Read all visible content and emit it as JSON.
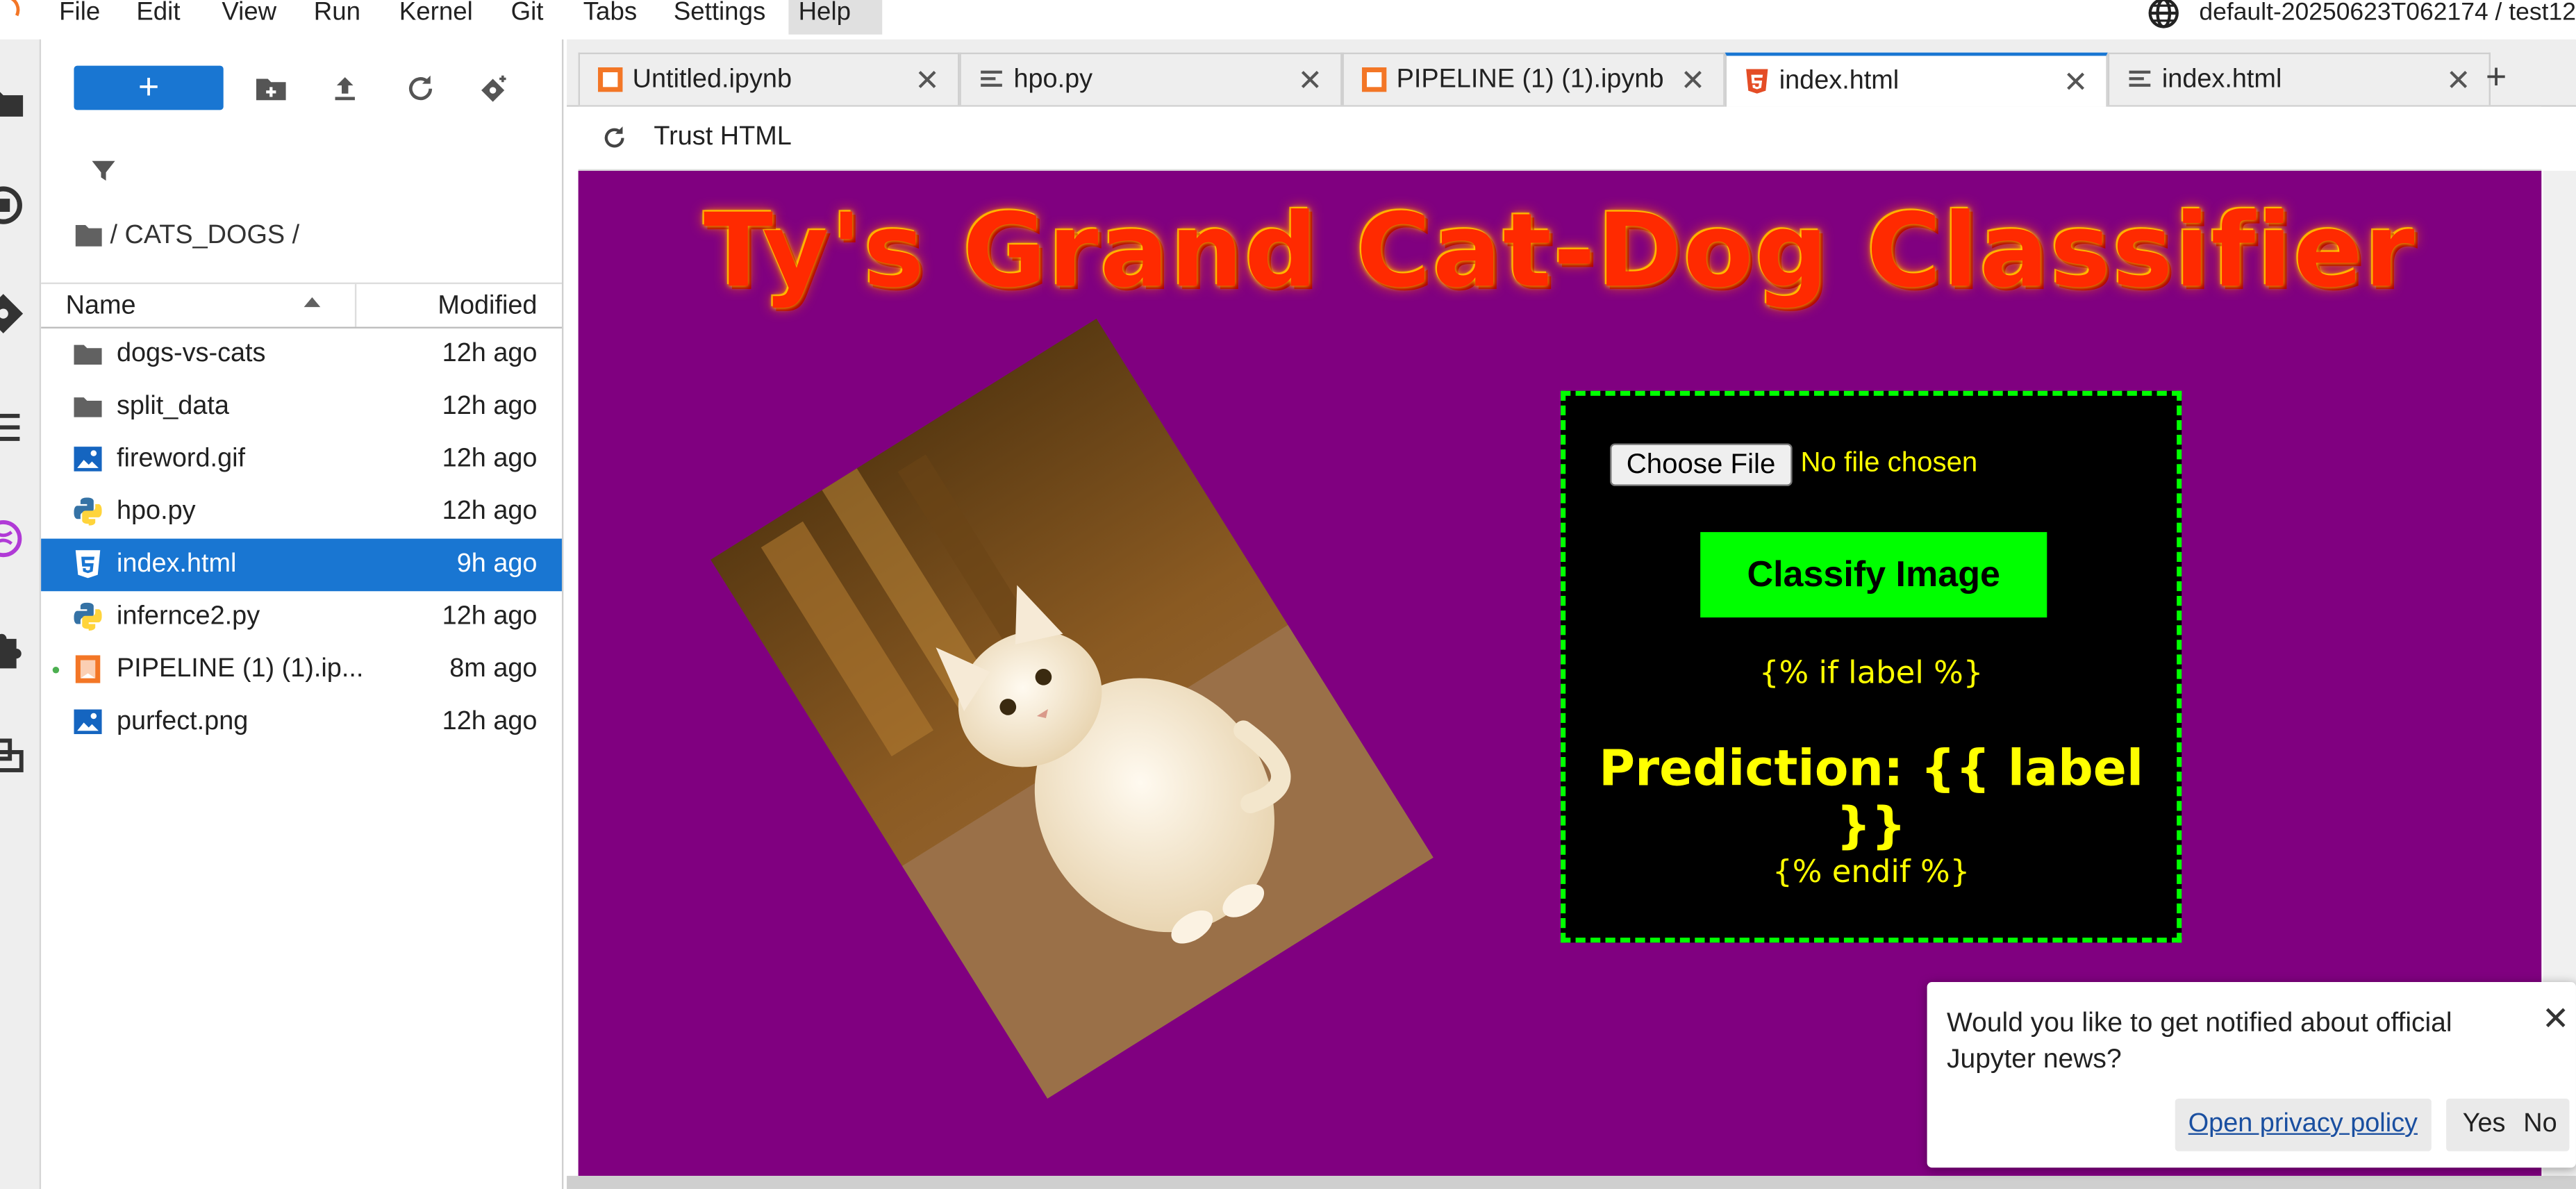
{
  "menubar": {
    "items": [
      "File",
      "Edit",
      "View",
      "Run",
      "Kernel",
      "Git",
      "Tabs",
      "Settings",
      "Help"
    ],
    "active": "Help",
    "workspace": "default-20250623T062174 / test12"
  },
  "filebrowser": {
    "new_label": "+",
    "breadcrumb": "/ CATS_DOGS /",
    "columns": {
      "name": "Name",
      "modified": "Modified"
    },
    "files": [
      {
        "name": "dogs-vs-cats",
        "modified": "12h ago",
        "icon": "folder-icon"
      },
      {
        "name": "split_data",
        "modified": "12h ago",
        "icon": "folder-icon"
      },
      {
        "name": "fireword.gif",
        "modified": "12h ago",
        "icon": "image-icon"
      },
      {
        "name": "hpo.py",
        "modified": "12h ago",
        "icon": "python-icon"
      },
      {
        "name": "index.html",
        "modified": "9h ago",
        "icon": "html-icon",
        "selected": true
      },
      {
        "name": "infernce2.py",
        "modified": "12h ago",
        "icon": "python-icon"
      },
      {
        "name": "PIPELINE (1) (1).ip...",
        "modified": "8m ago",
        "icon": "notebook-icon",
        "running": true
      },
      {
        "name": "purfect.png",
        "modified": "12h ago",
        "icon": "image-icon"
      }
    ]
  },
  "tabs": [
    {
      "label": "Untitled.ipynb",
      "icon": "notebook-icon"
    },
    {
      "label": "hpo.py",
      "icon": "text-file-icon"
    },
    {
      "label": "PIPELINE (1) (1).ipynb",
      "icon": "notebook-icon"
    },
    {
      "label": "index.html",
      "icon": "html-icon",
      "active": true
    },
    {
      "label": "index.html",
      "icon": "text-file-icon"
    }
  ],
  "doc_toolbar": {
    "trust_label": "Trust HTML"
  },
  "rendered_page": {
    "title": "Ty's Grand Cat-Dog Classifier",
    "choose_file_label": "Choose File",
    "no_file_text": "No file chosen",
    "classify_label": "Classify Image",
    "template_if": "{% if label %}",
    "prediction": "Prediction: {{ label }}",
    "template_endif": "{% endif %}",
    "background_color": "#800080",
    "panel_border_color": "#00ff00",
    "text_color": "#ffff00"
  },
  "notification": {
    "message": "Would you like to get notified about official Jupyter news?",
    "privacy_label": "Open privacy policy",
    "yes_label": "Yes",
    "no_label": "No"
  },
  "colors": {
    "accent": "#1976d2",
    "jupyter_orange": "#f37626"
  }
}
